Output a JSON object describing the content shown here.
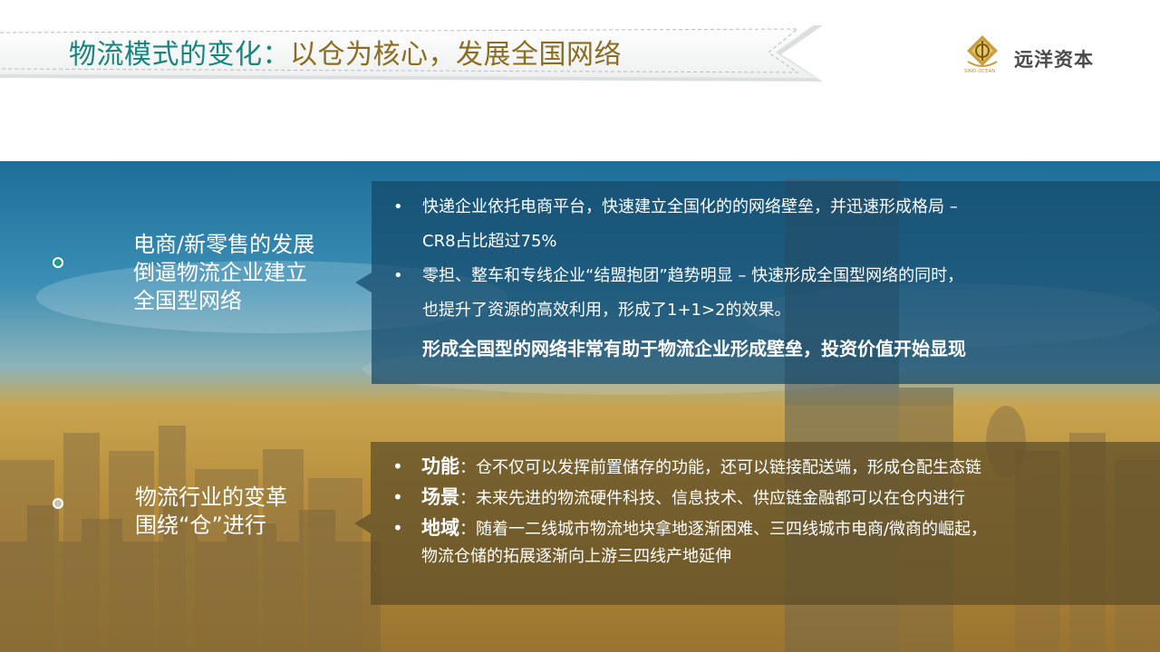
{
  "header": {
    "title_part1": "物流模式的变化：",
    "title_part2": "以仓为核心，发展全国网络",
    "logo_small": "SINO-OCEAN",
    "logo_name": "远洋资本",
    "title_color_1": "#17857d",
    "title_color_2": "#8c6d1f"
  },
  "section1": {
    "label_lines": [
      "电商/新零售的发展",
      "倒逼物流企业建立",
      "全国型网络"
    ],
    "bullets": [
      {
        "symbol": "•",
        "lines": [
          "快递企业依托电商平台，快速建立全国化的的网络壁垒，并迅速形成格局 –",
          "CR8占比超过75%"
        ]
      },
      {
        "symbol": "•",
        "lines": [
          "零担、整车和专线企业“结盟抱团”趋势明显 – 快速形成全国型网络的同时，",
          "也提升了资源的高效利用，形成了1+1>2的效果。"
        ]
      }
    ],
    "emphasis": "形成全国型的网络非常有助于物流企业形成壁垒，投资价值开始显现"
  },
  "section2": {
    "label_lines": [
      "物流行业的变革",
      "围绕“仓”进行"
    ],
    "bullets": [
      {
        "symbol": "•",
        "keyword": "功能",
        "lines": [
          "：仓不仅可以发挥前置储存的功能，还可以链接配送端，形成仓配生态链"
        ]
      },
      {
        "symbol": "•",
        "keyword": "场景",
        "lines": [
          "：未来先进的物流硬件科技、信息技术、供应链金融都可以在仓内进行"
        ]
      },
      {
        "symbol": "•",
        "keyword": "地域",
        "lines": [
          "：随着一二线城市物流地块拿地逐渐困难、三四线城市电商/微商的崛起，",
          "物流仓储的拓展逐渐向上游三四线产地延伸"
        ]
      }
    ]
  }
}
